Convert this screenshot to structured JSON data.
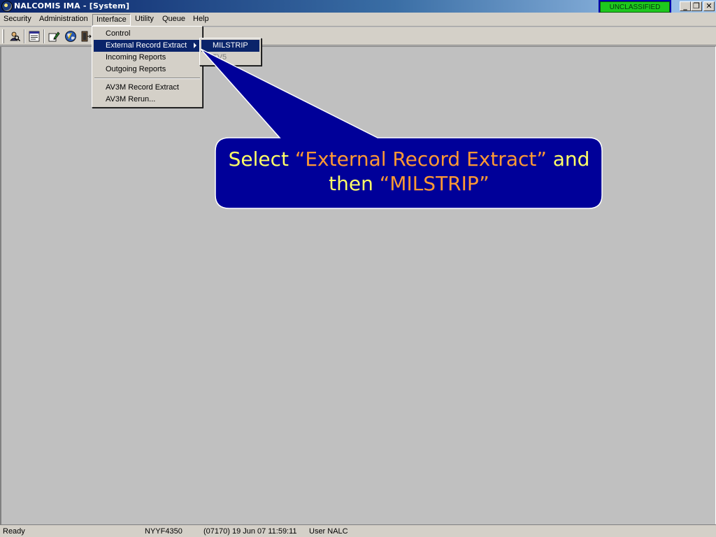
{
  "window": {
    "title": "NALCOMIS IMA - [System]",
    "classification": "UNCLASSIFIED",
    "minimize_glyph": "_",
    "restore_glyph": "❐",
    "close_glyph": "✕"
  },
  "menubar": {
    "items": [
      {
        "label": "Security"
      },
      {
        "label": "Administration"
      },
      {
        "label": "Interface"
      },
      {
        "label": "Utility"
      },
      {
        "label": "Queue"
      },
      {
        "label": "Help"
      }
    ]
  },
  "toolbar": {
    "icons": [
      "search-person-icon",
      "report-icon",
      "edit-icon",
      "globe-icon",
      "exit-door-icon"
    ]
  },
  "interface_menu": {
    "items": [
      {
        "label": "Control"
      },
      {
        "label": "External Record Extract"
      },
      {
        "label": "Incoming Reports"
      },
      {
        "label": "Outgoing Reports"
      },
      {
        "label": "AV3M Record Extract"
      },
      {
        "label": "AV3M Rerun..."
      }
    ],
    "highlighted": "External Record Extract"
  },
  "external_submenu": {
    "items": [
      {
        "label": "MILSTRIP"
      },
      {
        "label": "TV5"
      }
    ],
    "highlighted": "MILSTRIP"
  },
  "callout": {
    "part1": "Select ",
    "quote1": "“External Record Extract”",
    "part2": " and then ",
    "quote2": "“MILSTRIP”",
    "bg_color": "#000099",
    "text_color": "#ffff66",
    "highlight_color": "#ff9933"
  },
  "statusbar": {
    "status": "Ready",
    "terminal": "NYYF4350",
    "datetime": "(07170)  19 Jun 07  11:59:11",
    "user": "User NALC"
  }
}
